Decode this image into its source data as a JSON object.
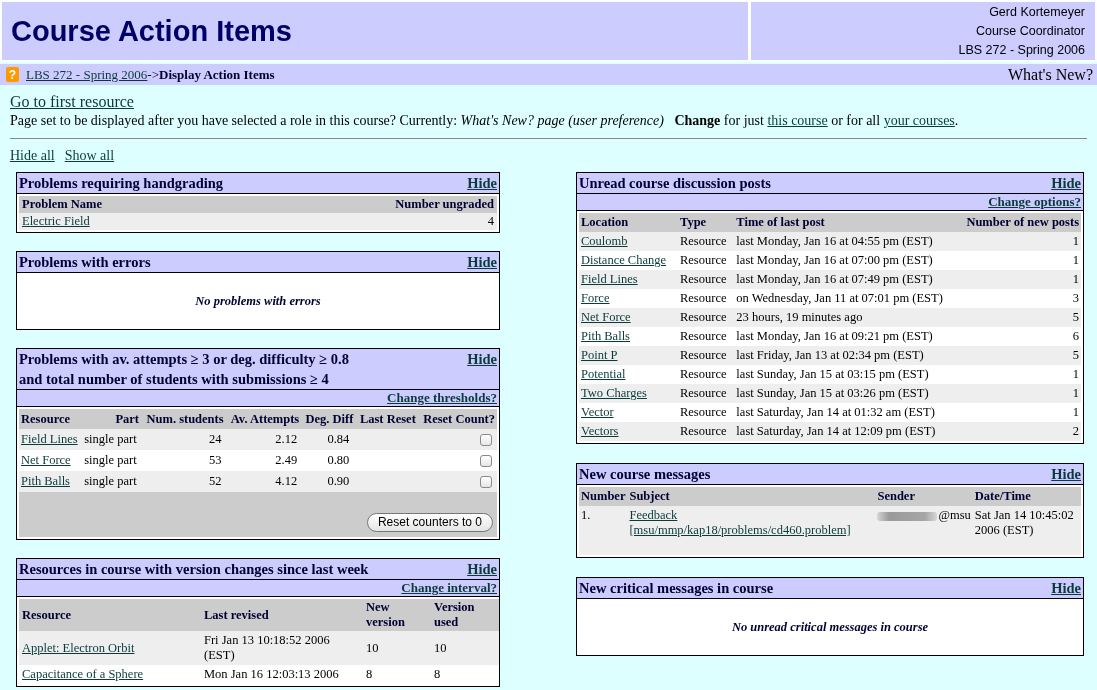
{
  "header": {
    "title": "Course Action Items",
    "user_name": "Gerd Kortemeyer",
    "user_role": "Course Coordinator",
    "course": "LBS 272 - Spring 2006"
  },
  "breadcrumb": {
    "help_icon": "?",
    "course_link": "LBS 272 - Spring 2006",
    "current": "->**Display Action Items**",
    "page_title": "What's New?"
  },
  "first_resource_link": "Go to first resource",
  "preference_note": [
    {
      "kind": "text",
      "text": "Page set to be displayed after you have selected a role in this course? Currently: *What's New? page (user preference)*   **Change** for just "
    },
    {
      "kind": "link",
      "text": "this course"
    },
    {
      "kind": "text",
      "text": " or for all "
    },
    {
      "kind": "link",
      "text": "your courses"
    },
    {
      "kind": "text",
      "text": "."
    }
  ],
  "display_links": {
    "hide_all": "Hide all",
    "show_all": "Show all"
  },
  "left_column": [
    {
      "kind": "handgrading",
      "title": "Problems requiring handgrading",
      "hide_link": "Hide",
      "columns": [
        "Problem Name",
        "Number ungraded"
      ],
      "rows": [
        {
          "cells": [
            {
              "kind": "link",
              "text": "Electric Field"
            },
            {
              "kind": "text",
              "text": "4"
            }
          ]
        }
      ]
    },
    {
      "kind": "errors",
      "title": "Problems with errors",
      "hide_link": "Hide",
      "empty_message": "No problems with errors"
    },
    {
      "kind": "attempts",
      "title": "Problems with av. attempts ≥ 3 or deg. difficulty ≥ 0.8 and total number of students with submissions ≥ 4",
      "hide_link": "Hide",
      "options_link": "Change thresholds?",
      "columns": [
        "Resource",
        "Part",
        "Num. students",
        "Av. Attempts",
        "Deg. Diff",
        "Last Reset",
        "Reset Count?"
      ],
      "rows": [
        {
          "cells": [
            {
              "kind": "link",
              "text": "Field Lines"
            },
            {
              "kind": "text",
              "text": "single part"
            },
            {
              "kind": "text",
              "text": "24"
            },
            {
              "kind": "text",
              "text": "2.12"
            },
            {
              "kind": "text",
              "text": "0.84"
            },
            {
              "kind": "blank"
            },
            {
              "kind": "checkbox",
              "checked": false
            }
          ]
        },
        {
          "cells": [
            {
              "kind": "link",
              "text": "Net Force"
            },
            {
              "kind": "text",
              "text": "single part"
            },
            {
              "kind": "text",
              "text": "53"
            },
            {
              "kind": "text",
              "text": "2.49"
            },
            {
              "kind": "text",
              "text": "0.80"
            },
            {
              "kind": "blank"
            },
            {
              "kind": "checkbox",
              "checked": false
            }
          ]
        },
        {
          "cells": [
            {
              "kind": "link",
              "text": "Pith Balls"
            },
            {
              "kind": "text",
              "text": "single part"
            },
            {
              "kind": "text",
              "text": "52"
            },
            {
              "kind": "text",
              "text": "4.12"
            },
            {
              "kind": "text",
              "text": "0.90"
            },
            {
              "kind": "blank"
            },
            {
              "kind": "checkbox",
              "checked": false
            }
          ]
        }
      ],
      "footer_button": "Reset counters to 0"
    },
    {
      "kind": "versions",
      "title": "Resources in course with version changes since last week",
      "hide_link": "Hide",
      "options_link": "Change interval?",
      "columns": [
        "Resource",
        "Last revised",
        "New version",
        "Version used"
      ],
      "rows": [
        {
          "cells": [
            {
              "kind": "link",
              "text": "Applet: Electron Orbit"
            },
            {
              "kind": "text",
              "text": "Fri Jan 13 10:18:52 2006 (EST)"
            },
            {
              "kind": "text",
              "text": "10"
            },
            {
              "kind": "text",
              "text": "10"
            }
          ]
        },
        {
          "cells": [
            {
              "kind": "link",
              "text": "Capacitance of a Sphere"
            },
            {
              "kind": "text",
              "text": "Mon Jan 16 12:03:13 2006"
            },
            {
              "kind": "text",
              "text": "8"
            },
            {
              "kind": "text",
              "text": "8"
            }
          ]
        }
      ]
    }
  ],
  "right_column": [
    {
      "kind": "discussions",
      "title": "Unread course discussion posts",
      "hide_link": "Hide",
      "options_link": "Change options?",
      "columns": [
        "Location",
        "Type",
        "Time of last post",
        "Number of new posts"
      ],
      "rows": [
        {
          "cells": [
            {
              "kind": "link",
              "text": "Coulomb"
            },
            {
              "kind": "text",
              "text": "Resource"
            },
            {
              "kind": "text",
              "text": "last Monday, Jan 16 at 04:55 pm (EST)"
            },
            {
              "kind": "text",
              "text": "1"
            }
          ]
        },
        {
          "cells": [
            {
              "kind": "link",
              "text": "Distance Change"
            },
            {
              "kind": "text",
              "text": "Resource"
            },
            {
              "kind": "text",
              "text": "last Monday, Jan 16 at 07:00 pm (EST)"
            },
            {
              "kind": "text",
              "text": "1"
            }
          ]
        },
        {
          "cells": [
            {
              "kind": "link",
              "text": "Field Lines"
            },
            {
              "kind": "text",
              "text": "Resource"
            },
            {
              "kind": "text",
              "text": "last Monday, Jan 16 at 07:49 pm (EST)"
            },
            {
              "kind": "text",
              "text": "1"
            }
          ]
        },
        {
          "cells": [
            {
              "kind": "link",
              "text": "Force"
            },
            {
              "kind": "text",
              "text": "Resource"
            },
            {
              "kind": "text",
              "text": "on Wednesday, Jan 11 at 07:01 pm (EST)"
            },
            {
              "kind": "text",
              "text": "3"
            }
          ]
        },
        {
          "cells": [
            {
              "kind": "link",
              "text": "Net Force"
            },
            {
              "kind": "text",
              "text": "Resource"
            },
            {
              "kind": "text",
              "text": "23 hours, 19 minutes ago"
            },
            {
              "kind": "text",
              "text": "5"
            }
          ]
        },
        {
          "cells": [
            {
              "kind": "link",
              "text": "Pith Balls"
            },
            {
              "kind": "text",
              "text": "Resource"
            },
            {
              "kind": "text",
              "text": "last Monday, Jan 16 at 09:21 pm (EST)"
            },
            {
              "kind": "text",
              "text": "6"
            }
          ]
        },
        {
          "cells": [
            {
              "kind": "link",
              "text": "Point P"
            },
            {
              "kind": "text",
              "text": "Resource"
            },
            {
              "kind": "text",
              "text": "last Friday, Jan 13 at 02:34 pm (EST)"
            },
            {
              "kind": "text",
              "text": "5"
            }
          ]
        },
        {
          "cells": [
            {
              "kind": "link",
              "text": "Potential"
            },
            {
              "kind": "text",
              "text": "Resource"
            },
            {
              "kind": "text",
              "text": "last Sunday, Jan 15 at 03:15 pm (EST)"
            },
            {
              "kind": "text",
              "text": "1"
            }
          ]
        },
        {
          "cells": [
            {
              "kind": "link",
              "text": "Two Charges"
            },
            {
              "kind": "text",
              "text": "Resource"
            },
            {
              "kind": "text",
              "text": "last Sunday, Jan 15 at 03:26 pm (EST)"
            },
            {
              "kind": "text",
              "text": "1"
            }
          ]
        },
        {
          "cells": [
            {
              "kind": "link",
              "text": "Vector"
            },
            {
              "kind": "text",
              "text": "Resource"
            },
            {
              "kind": "text",
              "text": "last Saturday, Jan 14 at 01:32 am (EST)"
            },
            {
              "kind": "text",
              "text": "1"
            }
          ]
        },
        {
          "cells": [
            {
              "kind": "link",
              "text": "Vectors"
            },
            {
              "kind": "text",
              "text": "Resource"
            },
            {
              "kind": "text",
              "text": "last Saturday, Jan 14 at 12:09 pm (EST)"
            },
            {
              "kind": "text",
              "text": "2"
            }
          ]
        }
      ]
    },
    {
      "kind": "messages",
      "title": "New course messages",
      "hide_link": "Hide",
      "columns": [
        "Number",
        "Subject",
        "Sender",
        "Date/Time"
      ],
      "rows": [
        {
          "cells": [
            {
              "kind": "text",
              "text": "1."
            },
            {
              "kind": "link",
              "text": "Feedback [msu/mmp/kap18/problems/cd460.problem]"
            },
            {
              "kind": "redacted",
              "text": "@msu"
            },
            {
              "kind": "text",
              "text": "Sat Jan 14 10:45:02 2006 (EST)"
            }
          ]
        }
      ]
    },
    {
      "kind": "critical",
      "title": "New critical messages in course",
      "hide_link": "Hide",
      "empty_message": "No unread critical messages in course"
    }
  ]
}
